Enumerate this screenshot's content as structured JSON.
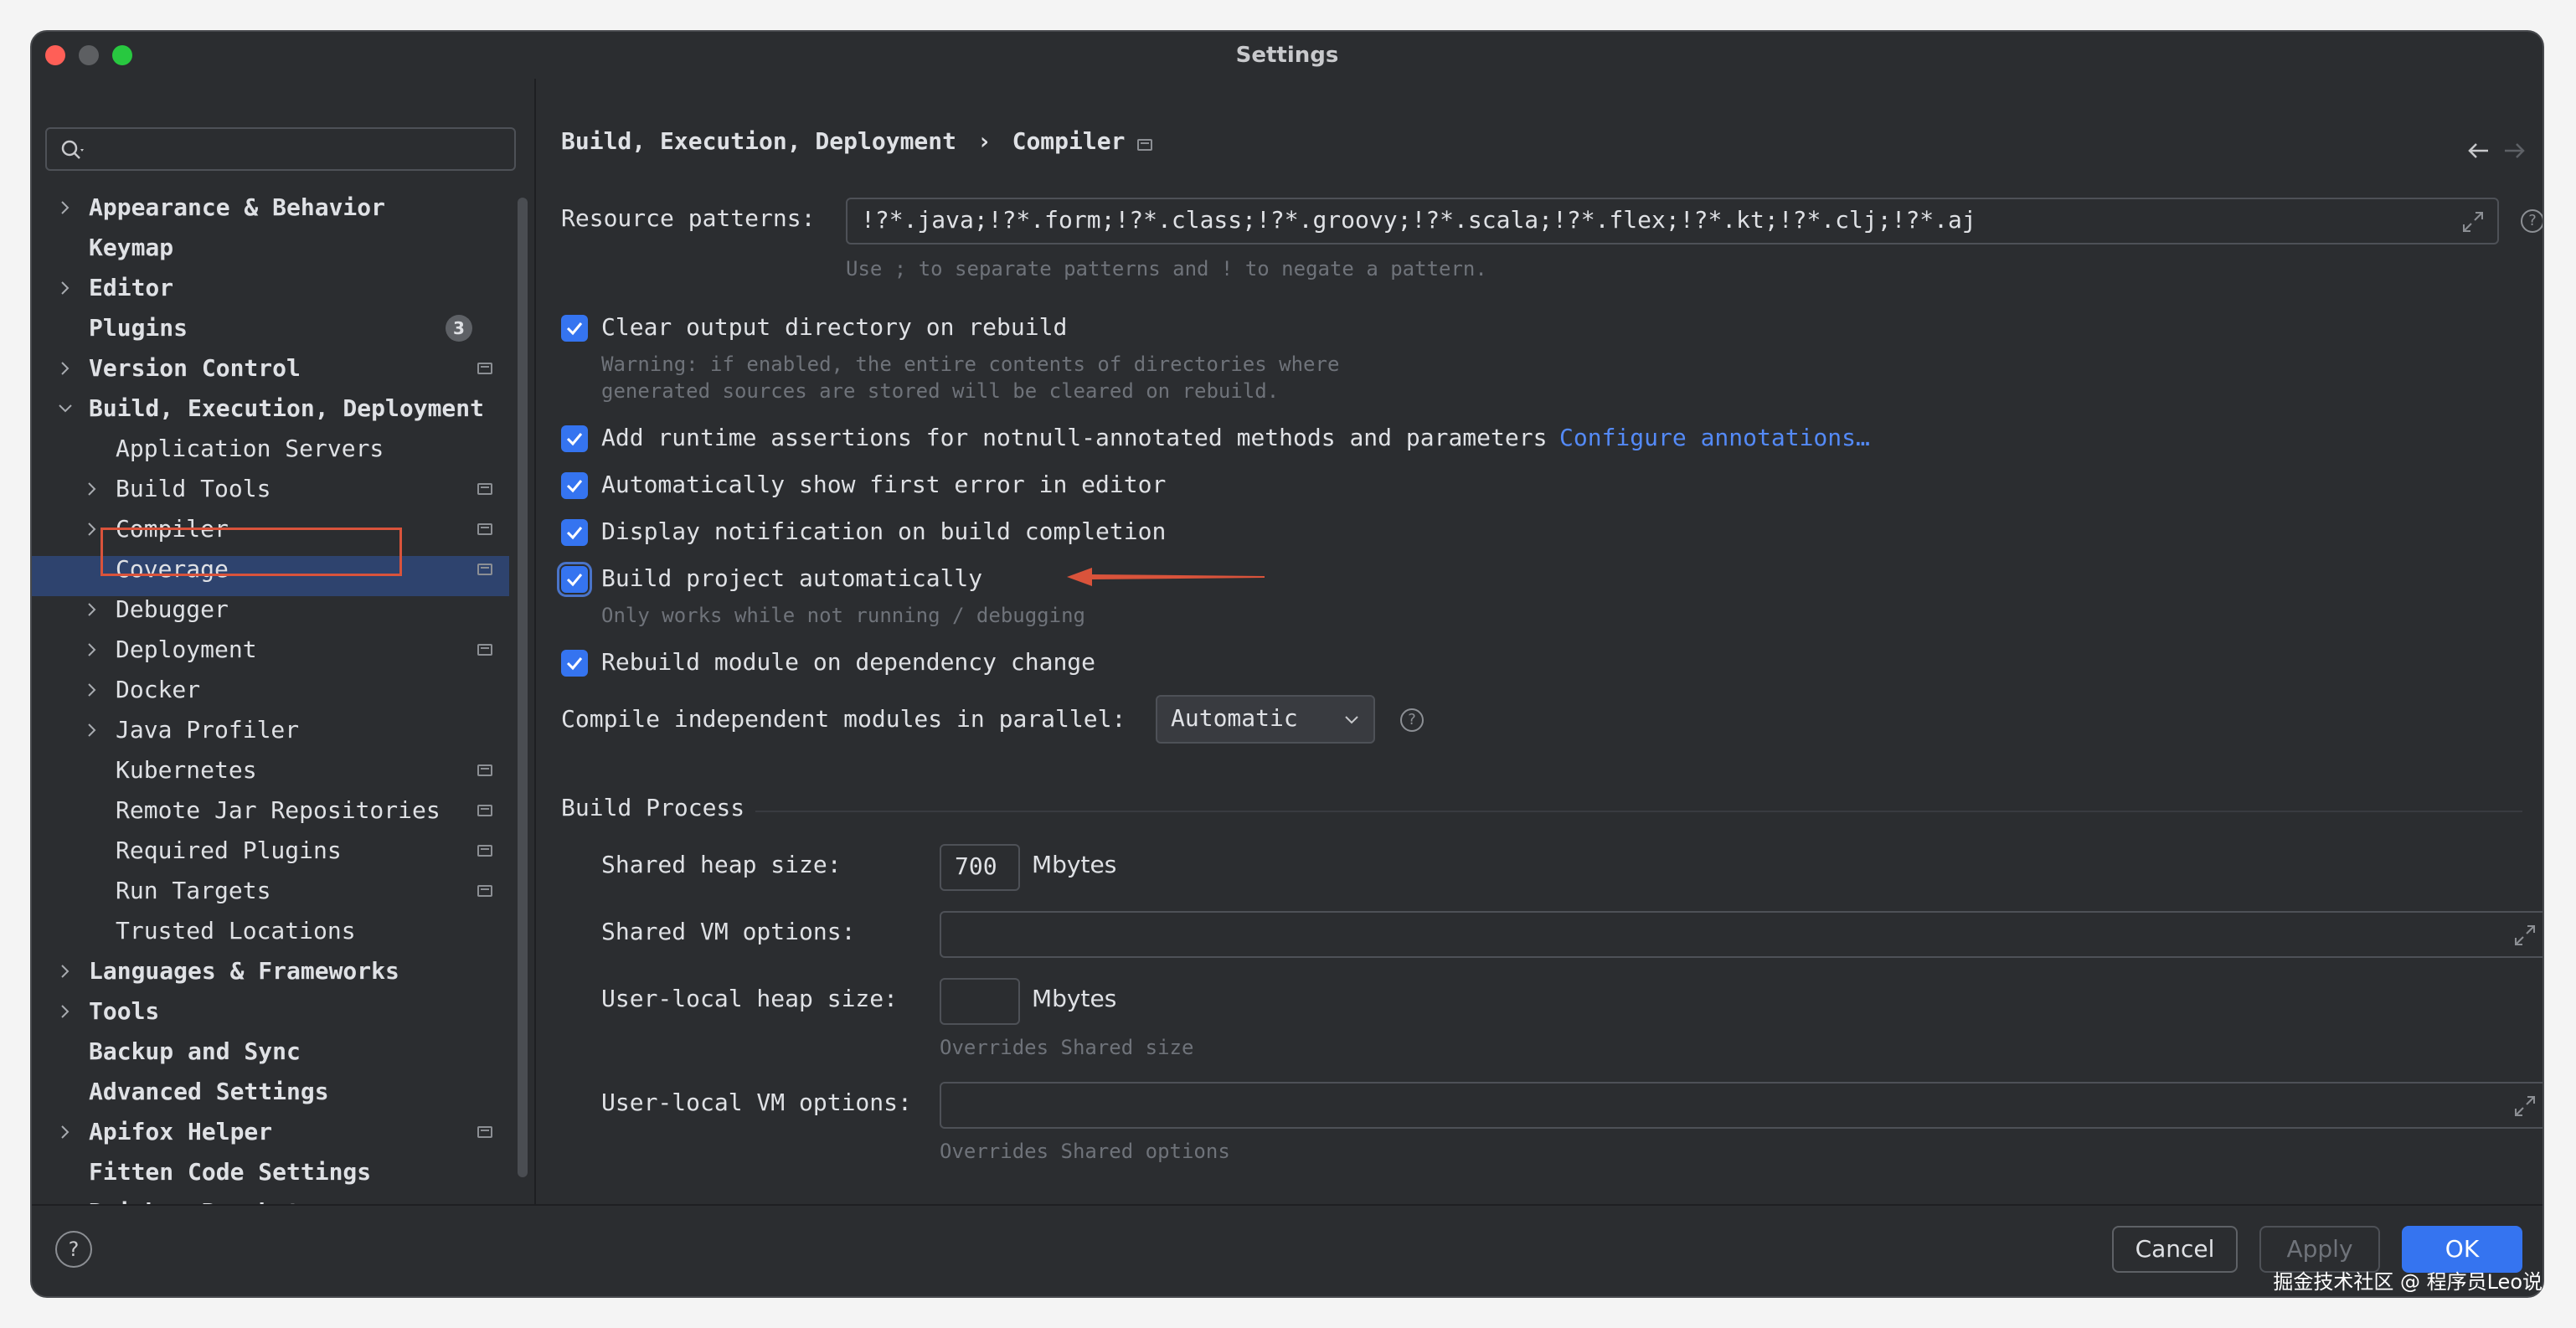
{
  "window": {
    "title": "Settings"
  },
  "sidebar": {
    "search_placeholder": "",
    "items": [
      {
        "label": "Appearance & Behavior",
        "bold": true
      },
      {
        "label": "Keymap",
        "bold": true
      },
      {
        "label": "Editor",
        "bold": true
      },
      {
        "label": "Plugins",
        "bold": true,
        "badge": "3"
      },
      {
        "label": "Version Control",
        "bold": true
      },
      {
        "label": "Build, Execution, Deployment",
        "bold": true,
        "expanded": true
      },
      {
        "label": "Application Servers"
      },
      {
        "label": "Build Tools"
      },
      {
        "label": "Compiler",
        "selected": true
      },
      {
        "label": "Coverage"
      },
      {
        "label": "Debugger"
      },
      {
        "label": "Deployment"
      },
      {
        "label": "Docker"
      },
      {
        "label": "Java Profiler"
      },
      {
        "label": "Kubernetes"
      },
      {
        "label": "Remote Jar Repositories"
      },
      {
        "label": "Required Plugins"
      },
      {
        "label": "Run Targets"
      },
      {
        "label": "Trusted Locations"
      },
      {
        "label": "Languages & Frameworks",
        "bold": true
      },
      {
        "label": "Tools",
        "bold": true
      },
      {
        "label": "Backup and Sync",
        "bold": true
      },
      {
        "label": "Advanced Settings",
        "bold": true
      },
      {
        "label": "Apifox Helper",
        "bold": true
      },
      {
        "label": "Fitten Code Settings",
        "bold": true
      },
      {
        "label": "Rainbow Brackets",
        "bold": true
      }
    ]
  },
  "breadcrumb": {
    "parent": "Build, Execution, Deployment",
    "separator": "›",
    "current": "Compiler"
  },
  "resource_patterns": {
    "label": "Resource patterns:",
    "value": "!?*.java;!?*.form;!?*.class;!?*.groovy;!?*.scala;!?*.flex;!?*.kt;!?*.clj;!?*.aj",
    "hint": "Use ; to separate patterns and ! to negate a pattern."
  },
  "options": {
    "clear_output": {
      "label": "Clear output directory on rebuild",
      "checked": true,
      "warning_line1": "Warning: if enabled, the entire contents of directories where",
      "warning_line2": "generated sources are stored will be cleared on rebuild."
    },
    "runtime_assertions": {
      "label": "Add runtime assertions for notnull-annotated methods and parameters",
      "checked": true,
      "link": "Configure annotations…"
    },
    "show_first_error": {
      "label": "Automatically show first error in editor",
      "checked": true
    },
    "display_notification": {
      "label": "Display notification on build completion",
      "checked": true
    },
    "build_automatically": {
      "label": "Build project automatically",
      "checked": true,
      "hint": "Only works while not running / debugging"
    },
    "rebuild_module": {
      "label": "Rebuild module on dependency change",
      "checked": true
    }
  },
  "parallel": {
    "label": "Compile independent modules in parallel:",
    "value": "Automatic"
  },
  "build_process": {
    "title": "Build Process",
    "shared_heap": {
      "label": "Shared heap size:",
      "value": "700",
      "unit": "Mbytes"
    },
    "shared_vm": {
      "label": "Shared VM options:",
      "value": ""
    },
    "user_heap": {
      "label": "User-local heap size:",
      "value": "",
      "unit": "Mbytes",
      "hint": "Overrides Shared size"
    },
    "user_vm": {
      "label": "User-local VM options:",
      "value": "",
      "hint": "Overrides Shared options"
    }
  },
  "footer": {
    "help": "?",
    "cancel": "Cancel",
    "apply": "Apply",
    "ok": "OK"
  },
  "watermark": "掘金技术社区 @ 程序员Leo说",
  "colors": {
    "accent": "#3574f0",
    "link": "#548af7",
    "selection": "#2e436e",
    "annotation": "#d9533b"
  }
}
